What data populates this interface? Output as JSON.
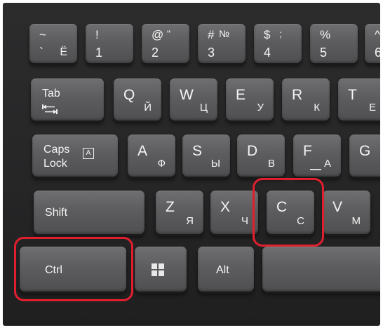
{
  "keyboard": {
    "row_numbers": [
      {
        "top": "~",
        "bottom": "`",
        "right": "Ё"
      },
      {
        "top": "!",
        "bottom": "1",
        "right": ""
      },
      {
        "top": "@",
        "bottom": "2",
        "right": "\""
      },
      {
        "top": "#",
        "bottom": "3",
        "right": "№"
      },
      {
        "top": "$",
        "bottom": "4",
        "right": ";"
      },
      {
        "top": "%",
        "bottom": "5",
        "right": ""
      },
      {
        "top": "^",
        "bottom": "6",
        "right": ""
      }
    ],
    "row_qwerty": [
      {
        "lat": "Q",
        "cyr": "Й"
      },
      {
        "lat": "W",
        "cyr": "Ц"
      },
      {
        "lat": "E",
        "cyr": "У"
      },
      {
        "lat": "R",
        "cyr": "К"
      },
      {
        "lat": "T",
        "cyr": "Е"
      }
    ],
    "row_home": [
      {
        "lat": "A",
        "cyr": "Ф"
      },
      {
        "lat": "S",
        "cyr": "Ы"
      },
      {
        "lat": "D",
        "cyr": "В"
      },
      {
        "lat": "F",
        "cyr": "А"
      },
      {
        "lat": "G",
        "cyr": ""
      }
    ],
    "row_shift": [
      {
        "lat": "Z",
        "cyr": "Я"
      },
      {
        "lat": "X",
        "cyr": "Ч"
      },
      {
        "lat": "C",
        "cyr": "С"
      },
      {
        "lat": "V",
        "cyr": "М"
      }
    ],
    "tab_label": "Tab",
    "caps_label_1": "Caps",
    "caps_label_2": "Lock",
    "caps_indicator": "A",
    "shift_label": "Shift",
    "ctrl_label": "Ctrl",
    "alt_label": "Alt",
    "highlight_color": "#e01f2e",
    "icons": [
      "windows-logo-icon",
      "tab-arrows-icon"
    ]
  }
}
